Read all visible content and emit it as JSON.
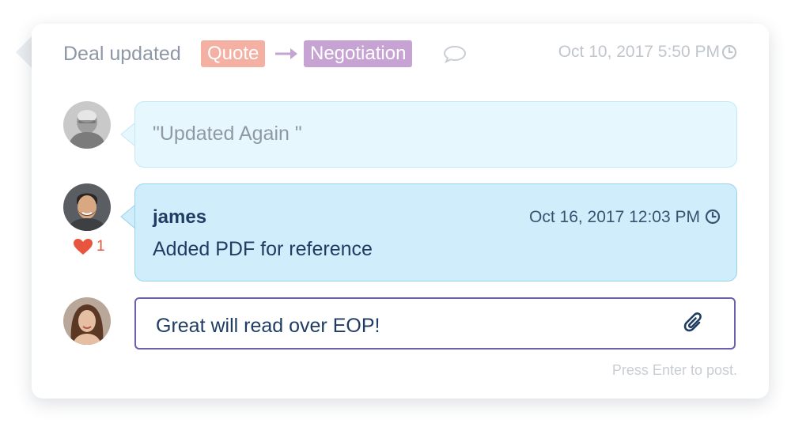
{
  "header": {
    "title": "Deal updated",
    "stage_from": "Quote",
    "stage_to": "Negotiation",
    "timestamp": "Oct 10, 2017 5:50 PM",
    "icons": [
      "arrow-right-icon",
      "comment-icon",
      "clock-icon"
    ]
  },
  "comments": [
    {
      "text": "\"Updated Again \""
    },
    {
      "author": "james",
      "timestamp": "Oct 16, 2017 12:03 PM",
      "text": "Added PDF for reference",
      "likes": "1"
    }
  ],
  "composer": {
    "value": "Great will read over EOP!",
    "hint": "Press Enter to post."
  },
  "colors": {
    "quote_tag": "#f4b0a3",
    "negotiation_tag": "#c7a3d3",
    "bubble_light": "#e6f7fd",
    "bubble_active": "#cfedfb",
    "input_border": "#6d5fae",
    "heart": "#e8553e"
  }
}
